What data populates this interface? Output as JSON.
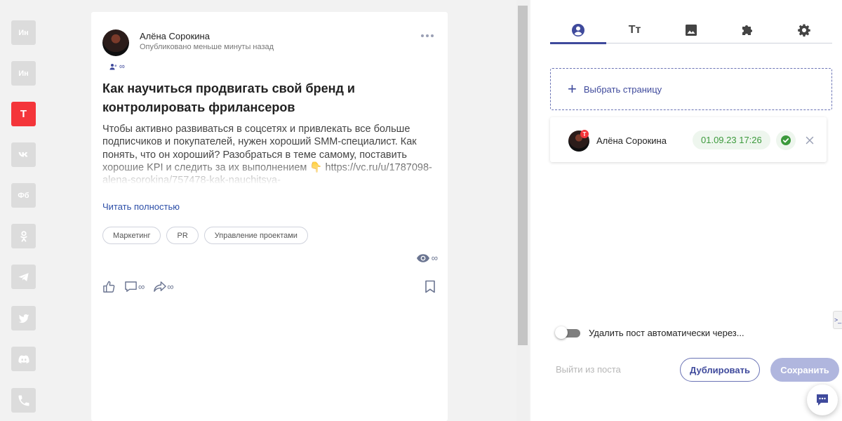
{
  "networks": [
    {
      "id": "instagram-1",
      "label": "Ин",
      "icon": "instagram-icon"
    },
    {
      "id": "instagram-2",
      "label": "Ин",
      "icon": "instagram-icon"
    },
    {
      "id": "tenchat",
      "label": "T",
      "icon": "tenchat-icon",
      "active": true
    },
    {
      "id": "vk",
      "label": "",
      "icon": "vk-icon"
    },
    {
      "id": "facebook",
      "label": "Фб",
      "icon": "facebook-icon"
    },
    {
      "id": "odnoklassniki",
      "label": "",
      "icon": "odnoklassniki-icon"
    },
    {
      "id": "telegram",
      "label": "",
      "icon": "telegram-icon"
    },
    {
      "id": "twitter",
      "label": "",
      "icon": "twitter-icon"
    },
    {
      "id": "discord",
      "label": "",
      "icon": "discord-icon"
    },
    {
      "id": "phone",
      "label": "",
      "icon": "phone-icon"
    }
  ],
  "post": {
    "author": "Алёна Сорокина",
    "published": "Опубликовано меньше минуты назад",
    "audience": "∞",
    "title": "Как научиться продвигать свой бренд и контролировать фрилансеров",
    "body": "Чтобы активно развиваться в соцсетях и привлекать все больше подписчиков и покупателей, нужен хороший SMM-специалист. Как понять, что он хороший? Разобраться в теме самому, поставить хорошие KPI и следить за их выполнением 👇 https://vc.ru/u/1787098-alena-sorokina/757478-kak-nauchitsya-",
    "read_more": "Читать полностью",
    "tags": [
      "Маркетинг",
      "PR",
      "Управление проектами"
    ],
    "views": "∞",
    "comments": "∞",
    "reposts": "∞"
  },
  "panel": {
    "tabs": [
      {
        "id": "profile",
        "icon": "user-circle-icon",
        "active": true
      },
      {
        "id": "text",
        "icon": "text-format-icon",
        "label": "Tт"
      },
      {
        "id": "image",
        "icon": "image-icon"
      },
      {
        "id": "plugins",
        "icon": "puzzle-icon"
      },
      {
        "id": "settings",
        "icon": "gear-icon"
      }
    ],
    "choose_page": "Выбрать страницу",
    "account": {
      "name": "Алёна Сорокина",
      "datetime": "01.09.23 17:26",
      "badge": "T"
    },
    "auto_delete": "Удалить пост автоматически через...",
    "exit": "Выйти из поста",
    "duplicate": "Дублировать",
    "save": "Сохранить",
    "edge_tab": ">_"
  },
  "colors": {
    "accent": "#3f4a9c",
    "tenchat_red": "#f4353a",
    "success": "#3c9a3c",
    "link": "#2d4fa8"
  }
}
